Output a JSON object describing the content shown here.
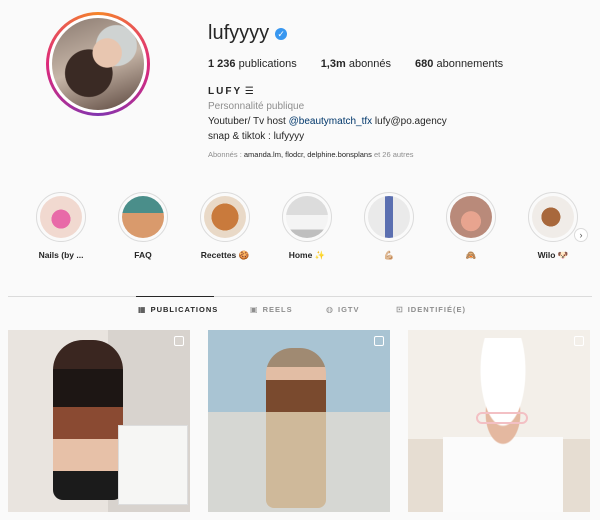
{
  "profile": {
    "username": "lufyyyy",
    "stats": {
      "posts_count": "1 236",
      "posts_label": "publications",
      "followers_count": "1,3m",
      "followers_label": "abonnés",
      "following_count": "680",
      "following_label": "abonnements"
    },
    "full_name": "LUFY",
    "category": "Personnalité publique",
    "bio_line1_prefix": "Youtuber/ Tv host ",
    "bio_mention": "@beautymatch_tfx",
    "bio_line1_suffix": " lufy@po.agency",
    "bio_line2": "snap & tiktok : lufyyyy",
    "followed_by_prefix": "Abonnés : ",
    "followed_by_names": "amanda.lm, flodcr, delphine.bonsplans",
    "followed_by_suffix": " et 26 autres"
  },
  "highlights": [
    {
      "label": "Nails (by ..."
    },
    {
      "label": "FAQ"
    },
    {
      "label": "Recettes 🍪"
    },
    {
      "label": "Home ✨"
    },
    {
      "label": "💪🏼"
    },
    {
      "label": "🙈"
    },
    {
      "label": "Wilo 🐶"
    }
  ],
  "tabs": [
    {
      "label": "PUBLICATIONS",
      "icon": "grid-icon"
    },
    {
      "label": "REELS",
      "icon": "reels-icon"
    },
    {
      "label": "IGTV",
      "icon": "igtv-icon"
    },
    {
      "label": "IDENTIFIÉ(E)",
      "icon": "tagged-icon"
    }
  ],
  "colors": {
    "verified": "#3897f0",
    "mention": "#00376b",
    "ring": "#dd2a7b"
  }
}
